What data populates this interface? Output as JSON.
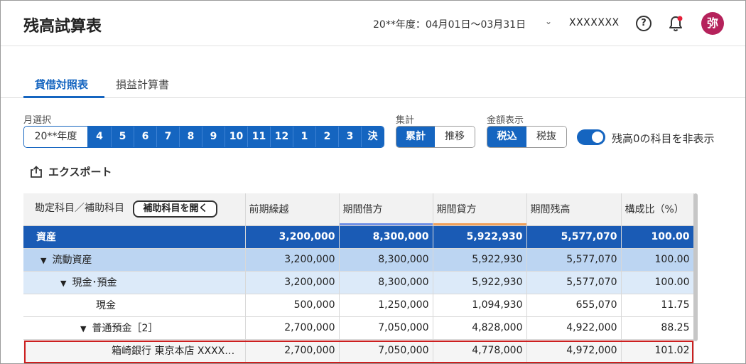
{
  "header": {
    "title": "残高試算表",
    "period": "20**年度：04月01日〜03月31日",
    "company": "XXXXXXX",
    "help_glyph": "?",
    "avatar_char": "弥"
  },
  "tabs": [
    {
      "label": "貸借対照表",
      "active": true
    },
    {
      "label": "損益計算書",
      "active": false
    }
  ],
  "filters": {
    "month_label": "月選択",
    "fiscal_year": "20**年度",
    "months": [
      "4",
      "5",
      "6",
      "7",
      "8",
      "9",
      "10",
      "11",
      "12",
      "1",
      "2",
      "3",
      "決"
    ],
    "aggregate_label": "集計",
    "aggregate_options": [
      "累計",
      "推移"
    ],
    "amount_label": "金額表示",
    "amount_options": [
      "税込",
      "税抜"
    ],
    "hide_zero_label": "残高0の科目を非表示",
    "hide_zero_on": true
  },
  "export_label": "エクスポート",
  "table": {
    "col_account": "勘定科目／補助科目",
    "open_sub_button": "補助科目を開く",
    "columns": [
      "前期繰越",
      "期間借方",
      "期間貸方",
      "期間残高",
      "構成比（%）"
    ],
    "rows": [
      {
        "name": "資産",
        "values": [
          "3,200,000",
          "8,300,000",
          "5,922,930",
          "5,577,070",
          "100.00"
        ]
      },
      {
        "name": "流動資産",
        "values": [
          "3,200,000",
          "8,300,000",
          "5,922,930",
          "5,577,070",
          "100.00"
        ]
      },
      {
        "name": "現金･預金",
        "values": [
          "3,200,000",
          "8,300,000",
          "5,922,930",
          "5,577,070",
          "100.00"
        ]
      },
      {
        "name": "現金",
        "values": [
          "500,000",
          "1,250,000",
          "1,094,930",
          "655,070",
          "11.75"
        ]
      },
      {
        "name": "普通預金［2］",
        "values": [
          "2,700,000",
          "7,050,000",
          "4,828,000",
          "4,922,000",
          "88.25"
        ]
      },
      {
        "name": "箱崎銀行 東京本店 XXXX…",
        "values": [
          "2,700,000",
          "7,050,000",
          "4,778,000",
          "4,972,000",
          "101.02"
        ]
      }
    ]
  },
  "colors": {
    "accent": "#1565c0",
    "row_level0": "#1a5bb5",
    "row_level1": "#bcd5f2",
    "row_level2": "#dceaf9",
    "highlight": "#cc1f1f",
    "avatar": "#b5225b"
  }
}
